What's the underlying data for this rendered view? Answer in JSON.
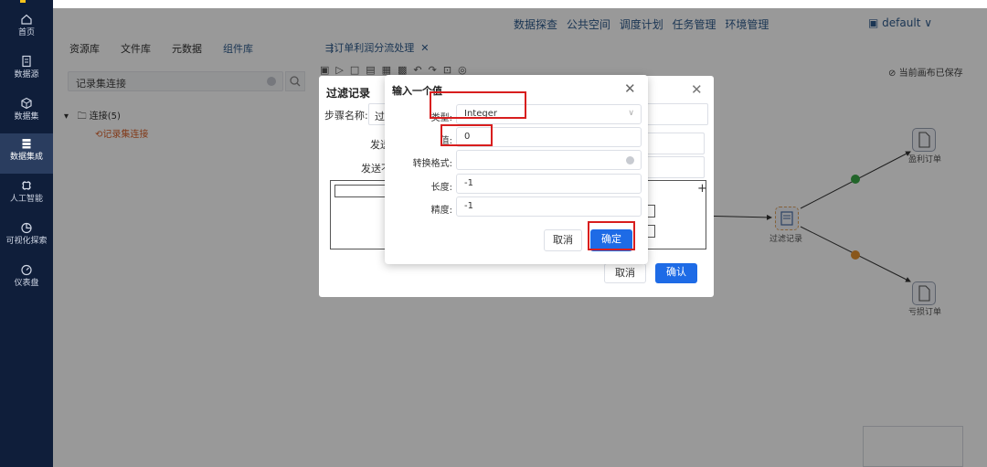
{
  "sidebar": {
    "items": [
      {
        "label": "首页",
        "icon": "home-icon"
      },
      {
        "label": "数据源",
        "icon": "datasource-icon"
      },
      {
        "label": "数据集",
        "icon": "dataset-icon"
      },
      {
        "label": "数据集成",
        "icon": "integration-icon",
        "active": true
      },
      {
        "label": "人工智能",
        "icon": "ai-icon"
      },
      {
        "label": "可视化探索",
        "icon": "chart-pie-icon"
      },
      {
        "label": "仪表盘",
        "icon": "dashboard-icon"
      }
    ]
  },
  "topbar": {
    "nav": [
      "数据探查",
      "公共空间",
      "调度计划",
      "任务管理",
      "环境管理"
    ],
    "workspace": "default"
  },
  "left_panel": {
    "tabs": [
      "资源库",
      "文件库",
      "元数据",
      "组件库"
    ],
    "search_value": "记录集连接",
    "tree_root": "连接(5)",
    "tree_child": "记录集连接"
  },
  "canvas": {
    "tab_title": "订单利润分流处理",
    "saved_status": "当前画布已保存",
    "nodes": {
      "filter": "过滤记录",
      "profit": "盈利订单",
      "loss": "亏损订单"
    }
  },
  "back_dialog": {
    "title": "过滤记录",
    "step_name_label": "步骤名称:",
    "step_name_value": "过",
    "send_true_label": "发送",
    "send_false_label": "发送不",
    "cancel": "取消",
    "confirm": "确认"
  },
  "front_dialog": {
    "title": "输入一个值",
    "fields": {
      "type_label": "类型:",
      "type_value": "Integer",
      "value_label": "值:",
      "value_value": "0",
      "format_label": "转换格式:",
      "format_value": "",
      "length_label": "长度:",
      "length_value": "-1",
      "precision_label": "精度:",
      "precision_value": "-1"
    },
    "cancel": "取消",
    "confirm": "确定"
  },
  "colors": {
    "sidebar_bg": "#0f1e3a",
    "primary": "#1e6be6",
    "highlight_box": "#d81e1e"
  }
}
